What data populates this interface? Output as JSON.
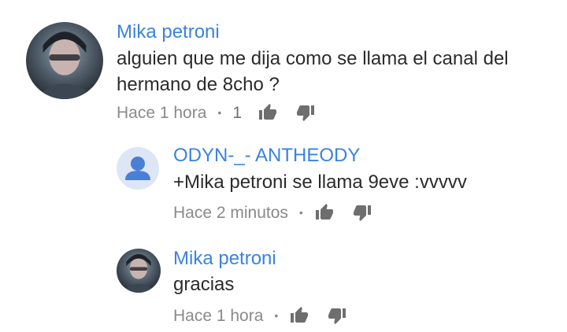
{
  "comments": [
    {
      "author": "Mika petroni",
      "text_lines": [
        "alguien que me dija como se llama el canal del",
        "hermano de 8cho ?"
      ],
      "time": "Hace 1 hora",
      "separator": "•",
      "likes": "1",
      "avatar_icon": "user-photo-avatar"
    },
    {
      "author": "ODYN-_- ANTHEODY",
      "text_lines": [
        "+Mika petroni se llama 9eve :vvvvv"
      ],
      "time": "Hace 2 minutos",
      "separator": "•",
      "avatar_icon": "default-person-avatar"
    },
    {
      "author": "Mika petroni",
      "text_lines": [
        "gracias"
      ],
      "time": "Hace 1 hora",
      "separator": "•",
      "avatar_icon": "user-photo-avatar"
    }
  ],
  "colors": {
    "author": "#3b82e0",
    "text": "#2b2b2b",
    "meta": "#8a8a8a",
    "icon": "#6e6e6e",
    "default_avatar_bg": "#dde6f5",
    "default_avatar_fg": "#4a7fd6"
  },
  "icons": {
    "like": "thumbs-up-icon",
    "dislike": "thumbs-down-icon"
  }
}
